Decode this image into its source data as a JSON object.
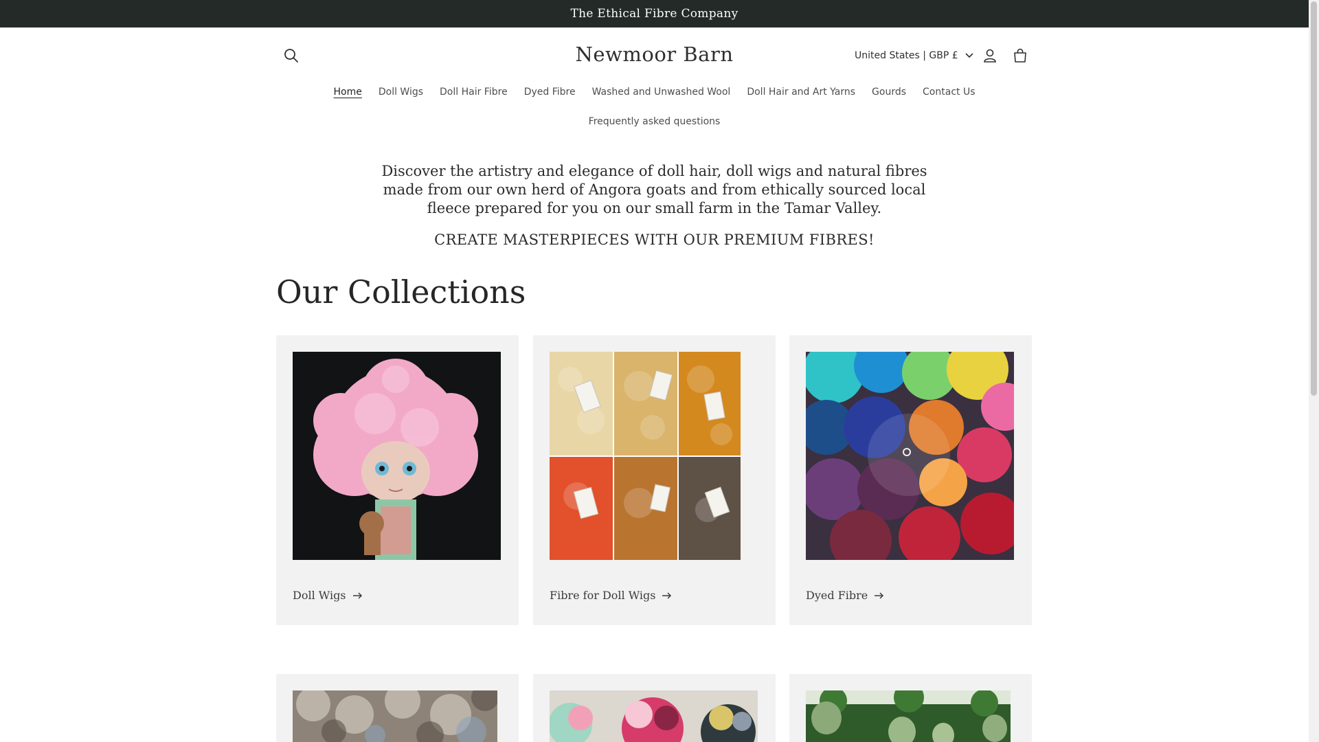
{
  "announcement": "The Ethical Fibre Company",
  "header": {
    "logo": "Newmoor Barn",
    "locale": "United States | GBP £",
    "icons": [
      "search-icon",
      "account-icon",
      "cart-icon",
      "chevron-down-icon"
    ]
  },
  "nav": {
    "row1": [
      "Home",
      "Doll Wigs",
      "Doll Hair Fibre",
      "Dyed Fibre",
      "Washed and Unwashed Wool",
      "Doll Hair and Art Yarns",
      "Gourds",
      "Contact Us"
    ],
    "row2": [
      "Frequently asked questions"
    ],
    "active": "Home"
  },
  "hero": {
    "lede": "Discover the artistry and elegance of doll hair, doll wigs and natural fibres made from our own herd of Angora goats and from ethically sourced local fleece prepared for you on our small farm in the Tamar Valley.",
    "tagline": "CREATE MASTERPIECES WITH OUR PREMIUM FIBRES!"
  },
  "collections": {
    "title": "Our Collections",
    "cards": [
      {
        "label": "Doll Wigs"
      },
      {
        "label": "Fibre for Doll Wigs"
      },
      {
        "label": "Dyed Fibre"
      }
    ]
  },
  "colors": {
    "announcement_bg": "#232a27",
    "card_bg": "#f2f2f2"
  }
}
